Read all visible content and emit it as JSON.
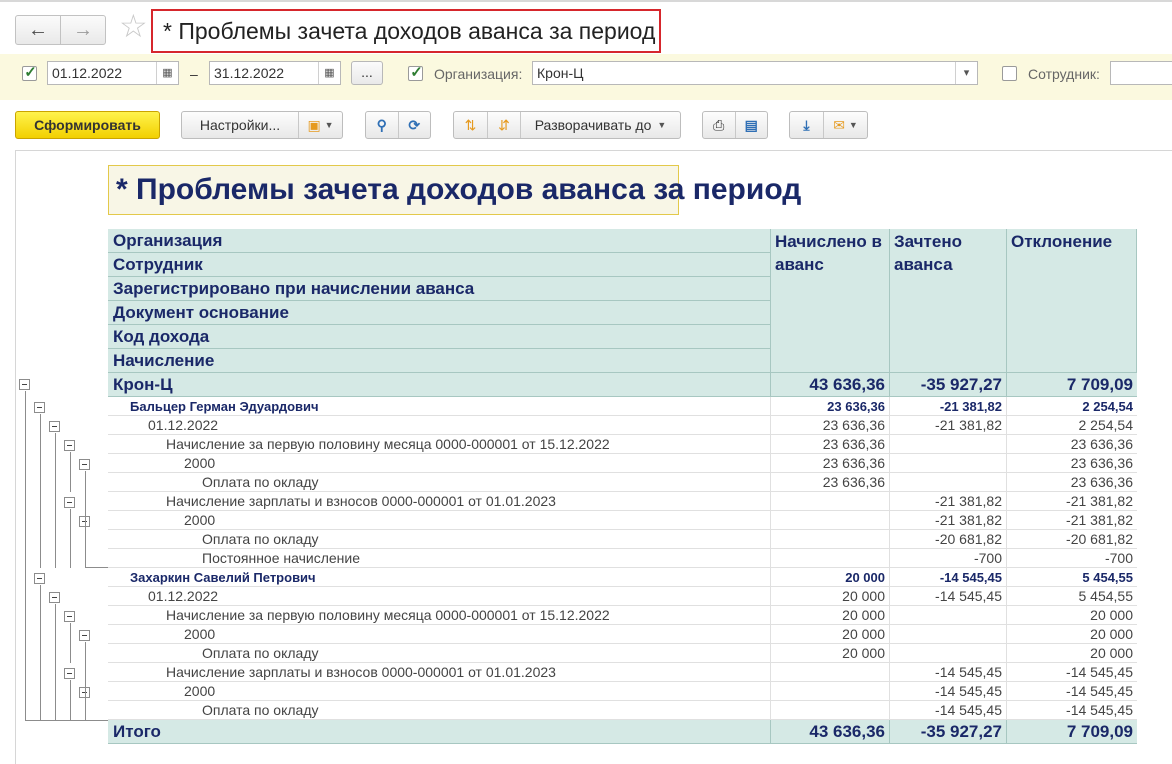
{
  "window": {
    "back_icon": "arrow-left-icon",
    "forward_icon": "arrow-right-icon",
    "favorite_icon": "star-icon",
    "title": "* Проблемы зачета доходов аванса за период"
  },
  "filters": {
    "period_enabled": true,
    "date_from": "01.12.2022",
    "date_separator": "–",
    "date_to": "31.12.2022",
    "period_button": "...",
    "org_enabled": true,
    "org_label": "Организация:",
    "org_value": "Крон-Ц",
    "employee_enabled": false,
    "employee_label": "Сотрудник:",
    "employee_value": ""
  },
  "toolbar": {
    "generate": "Сформировать",
    "settings": "Настройки...",
    "expand_to": "Разворачивать до",
    "icons": [
      "variant-icon",
      "search-icon",
      "refresh-search-icon",
      "sort-asc-icon",
      "sort-desc-icon",
      "print-icon",
      "preview-icon",
      "download-icon",
      "mail-icon"
    ]
  },
  "report": {
    "title": "* Проблемы зачета доходов аванса за период",
    "group_headers": [
      "Организация",
      "Сотрудник",
      "Зарегистрировано при начислении аванса",
      "Документ основание",
      "Код дохода",
      "Начисление"
    ],
    "col_accrued": "Начислено в аванс",
    "col_offset": "Зачтено аванса",
    "col_deviation": "Отклонение",
    "org_row": {
      "name": "Крон-Ц",
      "accrued": "43 636,36",
      "offset": "-35 927,27",
      "deviation": "7 709,09"
    },
    "rows": [
      {
        "name": "Бальцер Герман Эдуардович",
        "accrued": "23 636,36",
        "offset": "-21 381,82",
        "deviation": "2 254,54"
      },
      {
        "name": "01.12.2022",
        "accrued": "23 636,36",
        "offset": "-21 381,82",
        "deviation": "2 254,54"
      },
      {
        "name": "Начисление за первую половину месяца 0000-000001 от 15.12.2022",
        "accrued": "23 636,36",
        "offset": "",
        "deviation": "23 636,36"
      },
      {
        "name": "2000",
        "accrued": "23 636,36",
        "offset": "",
        "deviation": "23 636,36"
      },
      {
        "name": "Оплата по окладу",
        "accrued": "23 636,36",
        "offset": "",
        "deviation": "23 636,36"
      },
      {
        "name": "Начисление зарплаты и взносов 0000-000001 от 01.01.2023",
        "accrued": "",
        "offset": "-21 381,82",
        "deviation": "-21 381,82"
      },
      {
        "name": "2000",
        "accrued": "",
        "offset": "-21 381,82",
        "deviation": "-21 381,82"
      },
      {
        "name": "Оплата по окладу",
        "accrued": "",
        "offset": "-20 681,82",
        "deviation": "-20 681,82"
      },
      {
        "name": "Постоянное начисление",
        "accrued": "",
        "offset": "-700",
        "deviation": "-700"
      },
      {
        "name": "Захаркин Савелий Петрович",
        "accrued": "20 000",
        "offset": "-14 545,45",
        "deviation": "5 454,55"
      },
      {
        "name": "01.12.2022",
        "accrued": "20 000",
        "offset": "-14 545,45",
        "deviation": "5 454,55"
      },
      {
        "name": "Начисление за первую половину месяца 0000-000001 от 15.12.2022",
        "accrued": "20 000",
        "offset": "",
        "deviation": "20 000"
      },
      {
        "name": "2000",
        "accrued": "20 000",
        "offset": "",
        "deviation": "20 000"
      },
      {
        "name": "Оплата по окладу",
        "accrued": "20 000",
        "offset": "",
        "deviation": "20 000"
      },
      {
        "name": "Начисление зарплаты и взносов 0000-000001 от 01.01.2023",
        "accrued": "",
        "offset": "-14 545,45",
        "deviation": "-14 545,45"
      },
      {
        "name": "2000",
        "accrued": "",
        "offset": "-14 545,45",
        "deviation": "-14 545,45"
      },
      {
        "name": "Оплата по окладу",
        "accrued": "",
        "offset": "-14 545,45",
        "deviation": "-14 545,45"
      }
    ],
    "total": {
      "name": "Итого",
      "accrued": "43 636,36",
      "offset": "-35 927,27",
      "deviation": "7 709,09"
    }
  }
}
